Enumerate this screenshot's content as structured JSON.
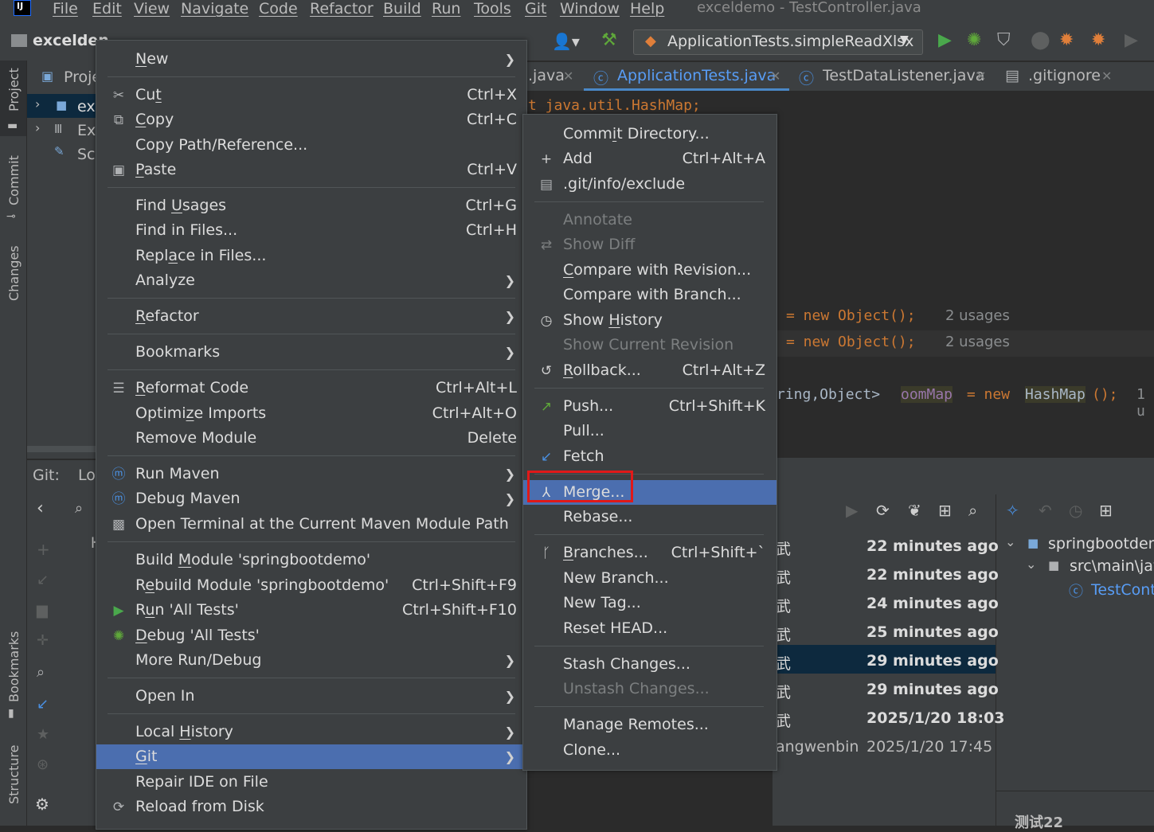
{
  "menubar": {
    "items": [
      "File",
      "Edit",
      "View",
      "Navigate",
      "Code",
      "Refactor",
      "Build",
      "Run",
      "Tools",
      "Git",
      "Window",
      "Help"
    ],
    "window_title": "exceldemo - TestController.java"
  },
  "toolbar": {
    "project_name": "excelden",
    "run_config": "ApplicationTests.simpleReadXlsx"
  },
  "stripe": {
    "project": "Project",
    "commit": "Commit",
    "changes": "Changes",
    "bookmarks": "Bookmarks",
    "structure": "Structure"
  },
  "project_panel": {
    "header": "Proje",
    "items": [
      "exc",
      "Ext",
      "Scr"
    ]
  },
  "git_panel": {
    "label": "Git:",
    "tab": "Lo"
  },
  "editor": {
    "tabs": [
      ".java",
      "ApplicationTests.java",
      "TestDataListener.java",
      ".gitignore"
    ],
    "line1": "t java.util.HashMap;",
    "line2_code": "= new Object();",
    "line2_usage": "2 usages",
    "line3_code": "= new Object();",
    "line3_usage": "2 usages",
    "line4_a": "ring,Object> ",
    "line4_var": "oomMap",
    "line4_b": " = new ",
    "line4_cls": "HashMap",
    "line4_c": "();",
    "line4_usage": "1 u"
  },
  "log": {
    "authors": [
      "武",
      "武",
      "武",
      "武",
      "武",
      "武",
      "武",
      "angwenbin"
    ],
    "times": [
      "22 minutes ago",
      "22 minutes ago",
      "24 minutes ago",
      "25 minutes ago",
      "29 minutes ago",
      "29 minutes ago",
      "2025/1/20 18:03",
      "2025/1/20 17:45"
    ],
    "tree": [
      "springbootdem",
      "src\\main\\jav",
      "TestContr"
    ],
    "footer": "测试22"
  },
  "context_menu": {
    "items": [
      {
        "pre": "",
        "u": "N",
        "post": "ew",
        "shortcut": "",
        "sub": true
      },
      {
        "pre": "Cu",
        "u": "t",
        "post": "",
        "shortcut": "Ctrl+X",
        "sub": false
      },
      {
        "pre": "",
        "u": "C",
        "post": "opy",
        "shortcut": "Ctrl+C",
        "sub": false
      },
      {
        "pre": "Copy Path/Reference...",
        "u": "",
        "post": "",
        "shortcut": "",
        "sub": false
      },
      {
        "pre": "",
        "u": "P",
        "post": "aste",
        "shortcut": "Ctrl+V",
        "sub": false
      },
      {
        "pre": "Find ",
        "u": "U",
        "post": "sages",
        "shortcut": "Ctrl+G",
        "sub": false
      },
      {
        "pre": "Find in Files...",
        "u": "",
        "post": "",
        "shortcut": "Ctrl+H",
        "sub": false
      },
      {
        "pre": "Repl",
        "u": "a",
        "post": "ce in Files...",
        "shortcut": "",
        "sub": false
      },
      {
        "pre": "Analyze",
        "u": "",
        "post": "",
        "shortcut": "",
        "sub": true
      },
      {
        "pre": "",
        "u": "R",
        "post": "efactor",
        "shortcut": "",
        "sub": true
      },
      {
        "pre": "Bookmarks",
        "u": "",
        "post": "",
        "shortcut": "",
        "sub": true
      },
      {
        "pre": "",
        "u": "R",
        "post": "eformat Code",
        "shortcut": "Ctrl+Alt+L",
        "sub": false
      },
      {
        "pre": "Optimi",
        "u": "z",
        "post": "e Imports",
        "shortcut": "Ctrl+Alt+O",
        "sub": false
      },
      {
        "pre": "Remove Module",
        "u": "",
        "post": "",
        "shortcut": "Delete",
        "sub": false
      },
      {
        "pre": "Run Maven",
        "u": "",
        "post": "",
        "shortcut": "",
        "sub": true
      },
      {
        "pre": "Debug Maven",
        "u": "",
        "post": "",
        "shortcut": "",
        "sub": true
      },
      {
        "pre": "Open Terminal at the Current Maven Module Path",
        "u": "",
        "post": "",
        "shortcut": "",
        "sub": false
      },
      {
        "pre": "Build ",
        "u": "M",
        "post": "odule 'springbootdemo'",
        "shortcut": "",
        "sub": false
      },
      {
        "pre": "R",
        "u": "e",
        "post": "build Module 'springbootdemo'",
        "shortcut": "Ctrl+Shift+F9",
        "sub": false
      },
      {
        "pre": "R",
        "u": "u",
        "post": "n 'All Tests'",
        "shortcut": "Ctrl+Shift+F10",
        "sub": false
      },
      {
        "pre": "",
        "u": "D",
        "post": "ebug 'All Tests'",
        "shortcut": "",
        "sub": false
      },
      {
        "pre": "More Run/Debug",
        "u": "",
        "post": "",
        "shortcut": "",
        "sub": true
      },
      {
        "pre": "Open In",
        "u": "",
        "post": "",
        "shortcut": "",
        "sub": true
      },
      {
        "pre": "Local ",
        "u": "H",
        "post": "istory",
        "shortcut": "",
        "sub": true
      },
      {
        "pre": "",
        "u": "G",
        "post": "it",
        "shortcut": "",
        "sub": true
      },
      {
        "pre": "Repair IDE on File",
        "u": "",
        "post": "",
        "shortcut": "",
        "sub": false
      },
      {
        "pre": "Reload from Disk",
        "u": "",
        "post": "",
        "shortcut": "",
        "sub": false
      }
    ]
  },
  "git_menu": {
    "items": [
      {
        "pre": "Comm",
        "u": "i",
        "post": "t Directory...",
        "shortcut": ""
      },
      {
        "pre": "Add",
        "u": "",
        "post": "",
        "shortcut": "Ctrl+Alt+A"
      },
      {
        "pre": ".git/info/exclude",
        "u": "",
        "post": "",
        "shortcut": ""
      },
      {
        "pre": "Annotate",
        "u": "",
        "post": "",
        "shortcut": ""
      },
      {
        "pre": "Show Diff",
        "u": "",
        "post": "",
        "shortcut": ""
      },
      {
        "pre": "",
        "u": "C",
        "post": "ompare with Revision...",
        "shortcut": ""
      },
      {
        "pre": "Compare with Branch...",
        "u": "",
        "post": "",
        "shortcut": ""
      },
      {
        "pre": "Show ",
        "u": "H",
        "post": "istory",
        "shortcut": ""
      },
      {
        "pre": "Show Current Revision",
        "u": "",
        "post": "",
        "shortcut": ""
      },
      {
        "pre": "",
        "u": "R",
        "post": "ollback...",
        "shortcut": "Ctrl+Alt+Z"
      },
      {
        "pre": "Push...",
        "u": "",
        "post": "",
        "shortcut": "Ctrl+Shift+K"
      },
      {
        "pre": "Pull...",
        "u": "",
        "post": "",
        "shortcut": ""
      },
      {
        "pre": "Fetch",
        "u": "",
        "post": "",
        "shortcut": ""
      },
      {
        "pre": "Merge...",
        "u": "",
        "post": "",
        "shortcut": ""
      },
      {
        "pre": "Rebase...",
        "u": "",
        "post": "",
        "shortcut": ""
      },
      {
        "pre": "",
        "u": "B",
        "post": "ranches...",
        "shortcut": "Ctrl+Shift+`"
      },
      {
        "pre": "New Branch...",
        "u": "",
        "post": "",
        "shortcut": ""
      },
      {
        "pre": "New Tag...",
        "u": "",
        "post": "",
        "shortcut": ""
      },
      {
        "pre": "Reset HEAD...",
        "u": "",
        "post": "",
        "shortcut": ""
      },
      {
        "pre": "Stash Changes...",
        "u": "",
        "post": "",
        "shortcut": ""
      },
      {
        "pre": "Unstash Changes...",
        "u": "",
        "post": "",
        "shortcut": ""
      },
      {
        "pre": "Manage Remotes...",
        "u": "",
        "post": "",
        "shortcut": ""
      },
      {
        "pre": "Clone...",
        "u": "",
        "post": "",
        "shortcut": ""
      }
    ]
  },
  "colors": {
    "selection": "#4b6eaf",
    "highlight_box": "#e01919",
    "menu_bg": "#3c3f41"
  }
}
